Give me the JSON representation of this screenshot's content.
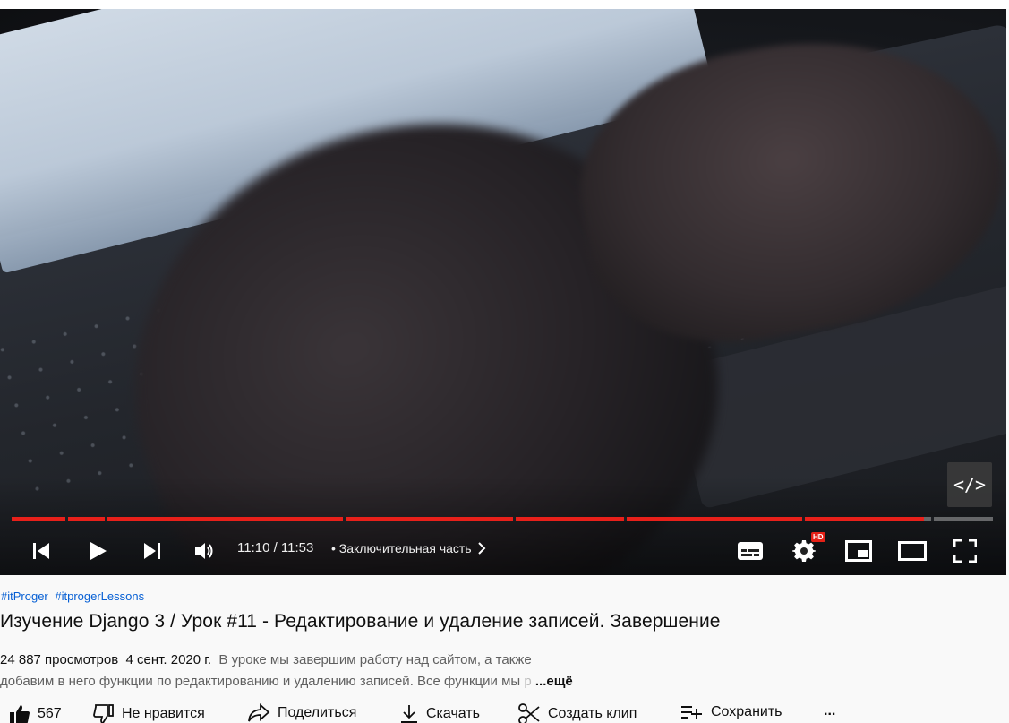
{
  "player": {
    "embed_label": "</>",
    "time": "11:10 / 11:53",
    "chapter": "• Заключительная часть",
    "hd_badge": "HD",
    "progress_fraction": 0.93
  },
  "video": {
    "hashtags": [
      "#itProger",
      "#itprogerLessons"
    ],
    "title": "Изучение Django 3 / Урок #11 - Редактирование и удаление записей. Завершение",
    "views": "24 887 просмотров",
    "date": "4 сент. 2020 г.",
    "description_line1": "В уроке мы завершим работу над сайтом, а также",
    "description_line2": "добавим в него функции по редактированию и удалению записей. Все функции мы ",
    "description_fade": "р",
    "more_label": "...ещё"
  },
  "actions": {
    "like_count": "567",
    "dislike_label": "Не нравится",
    "share_label": "Поделиться",
    "download_label": "Скачать",
    "clip_label": "Создать клип",
    "save_label": "Сохранить",
    "more_label": "..."
  },
  "colors": {
    "progress_red": "#e8201a",
    "link_blue": "#065fd4",
    "hd_red": "#e62117"
  }
}
